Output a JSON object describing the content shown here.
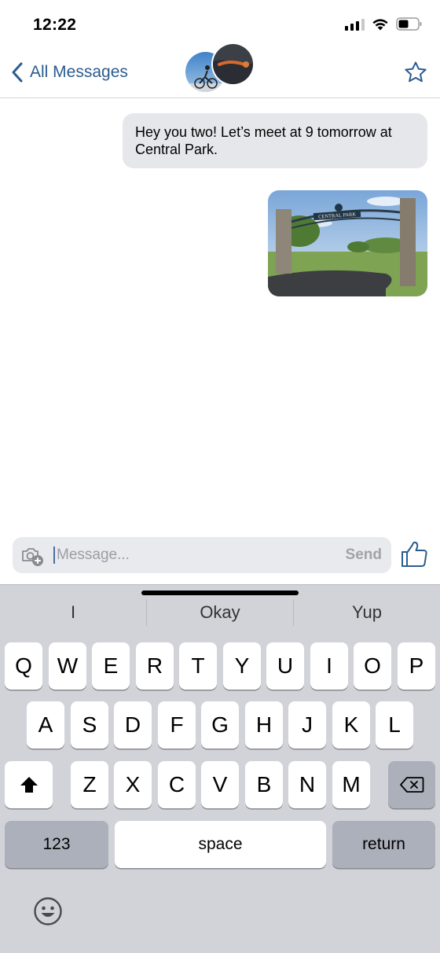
{
  "status_bar": {
    "time": "12:22"
  },
  "nav": {
    "back_label": "All Messages"
  },
  "messages": [
    {
      "type": "text",
      "text": "Hey you two! Let’s meet at 9 tomorrow at Central Park."
    },
    {
      "type": "photo",
      "photo_sign_text": "CENTRAL PARK"
    }
  ],
  "composer": {
    "placeholder": "Message...",
    "send_label": "Send"
  },
  "keyboard": {
    "suggestions": [
      "I",
      "Okay",
      "Yup"
    ],
    "row1": [
      "Q",
      "W",
      "E",
      "R",
      "T",
      "Y",
      "U",
      "I",
      "O",
      "P"
    ],
    "row2": [
      "A",
      "S",
      "D",
      "F",
      "G",
      "H",
      "J",
      "K",
      "L"
    ],
    "row3": [
      "Z",
      "X",
      "C",
      "V",
      "B",
      "N",
      "M"
    ],
    "numbers_label": "123",
    "space_label": "space",
    "return_label": "return"
  },
  "colors": {
    "accent": "#2b5c8f",
    "bubble": "#e6e7ea",
    "keyboard_bg": "#d1d3d9"
  }
}
